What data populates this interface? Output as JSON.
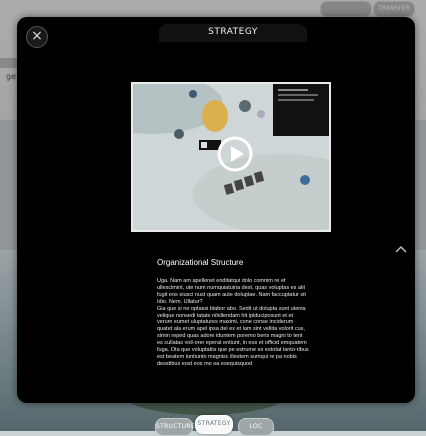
{
  "modal": {
    "title": "STRATEGY",
    "section_title": "Organizational Structure",
    "body": "Uga. Nam am apellenet enditatqui dolo comnim re et ullescimint, ute num numquiatuiria dest, quas voluptas es alit fugit eos eiusci nust quam aute doluptae. Nam faccuptatur sit Idio. Nem. Ullatur?\nGia que si ne optassi blabor abo. Sedit ut dolupta sunt utenia velique nonsedi tatate nihillendam hit ipiduciposunt et et verum eumet uluptatures maximi, cone conse inciderum quatet ala erum apel ipsa del ex et lam sint vellita volorit cus, simin reped quas adore iduntem poremo beris magni to tent es cullatas voil-orer eperat entiunt, in eos et officid emquatem fuga. Ota que voluptatiis que pe estrume ex estotat lanto-ribus est beatem iuntiunto magnisc illestem sumqui re pa nobis desstibus eost eos mo ea esequisquod"
  },
  "tabs": [
    {
      "label": "STRUCTURE",
      "active": false
    },
    {
      "label": "STRATEGY",
      "active": true
    },
    {
      "label": "LOC",
      "active": false
    }
  ],
  "background": {
    "left_text": "ge",
    "top_pills": [
      "TRANSFER"
    ]
  },
  "colors": {
    "modal_bg": "#000000",
    "active_tab": "#f5f7f8",
    "inactive_tab": "#9ea6a8"
  }
}
